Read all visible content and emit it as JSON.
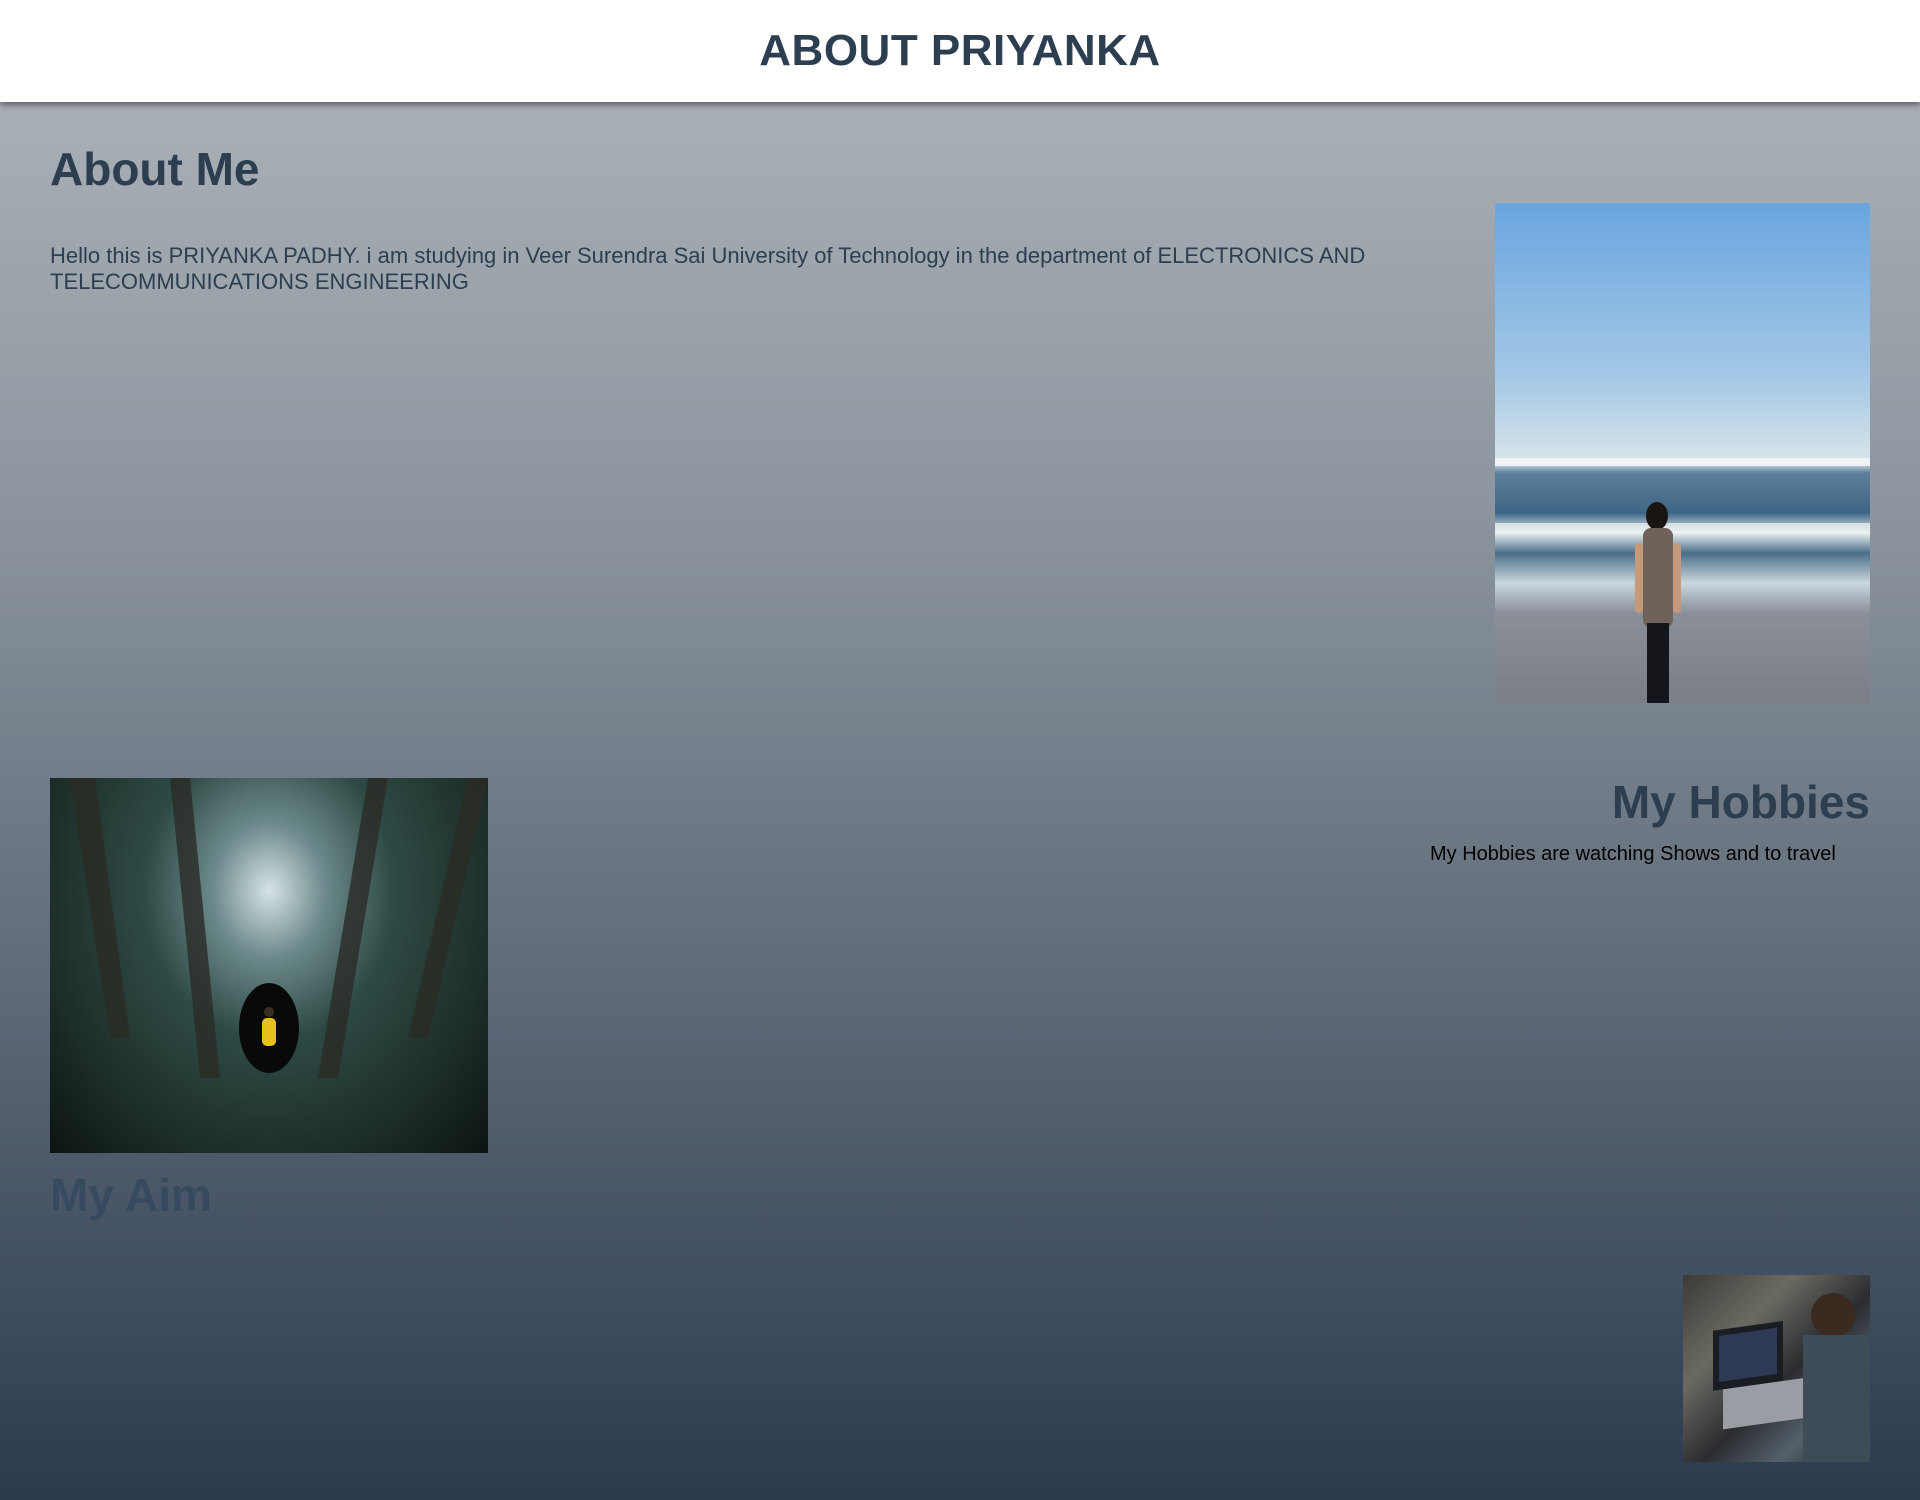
{
  "header": {
    "title": "ABOUT PRIYANKA"
  },
  "about": {
    "title": "About Me",
    "text": "Hello this is PRIYANKA PADHY. i am studying in Veer Surendra Sai University of Technology in the department of ELECTRONICS AND TELECOMMUNICATIONS ENGINEERING"
  },
  "hobbies": {
    "title": "My Hobbies",
    "text": "My Hobbies are watching Shows and to travel"
  },
  "aim": {
    "title": "My Aim"
  },
  "colors": {
    "heading": "#2c3e50",
    "header_bg": "#ffffff",
    "gradient_top": "#b0b6bc",
    "gradient_bottom": "#2c3a4e"
  }
}
